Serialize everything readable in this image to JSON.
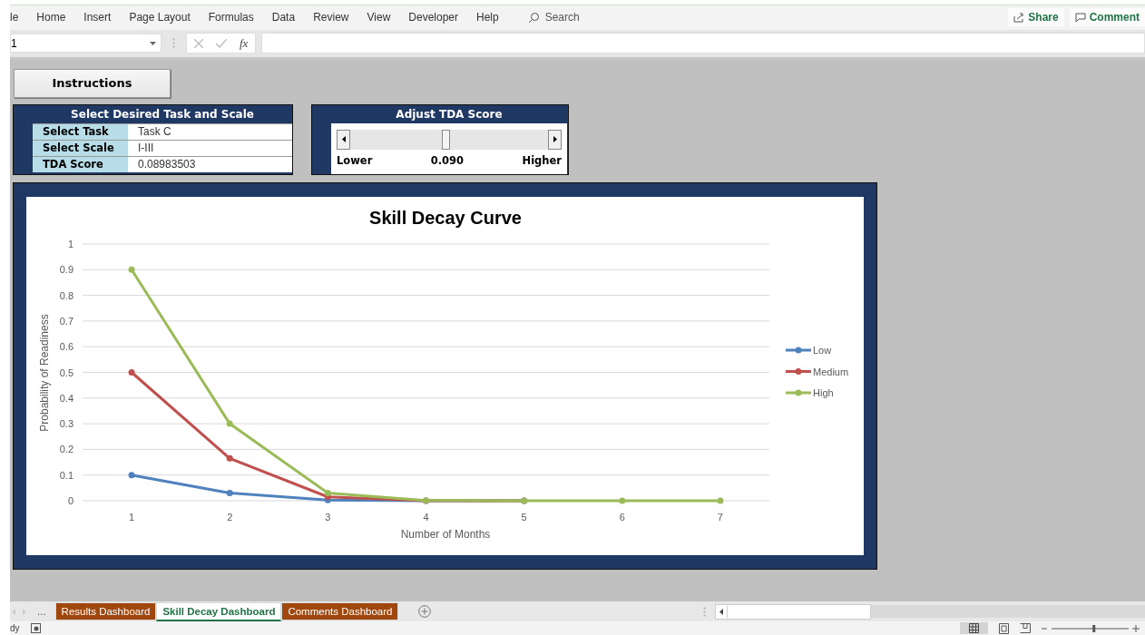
{
  "ribbon": {
    "tabs": [
      {
        "label": "le",
        "selected": false
      },
      {
        "label": "Home",
        "selected": false
      },
      {
        "label": "Insert",
        "selected": false
      },
      {
        "label": "Page Layout",
        "selected": false
      },
      {
        "label": "Formulas",
        "selected": false
      },
      {
        "label": "Data",
        "selected": false
      },
      {
        "label": "Review",
        "selected": false
      },
      {
        "label": "View",
        "selected": false
      },
      {
        "label": "Developer",
        "selected": false
      },
      {
        "label": "Help",
        "selected": false
      }
    ],
    "search": {
      "placeholder": "Search"
    },
    "buttons": [
      {
        "kind": "share",
        "label": "Share"
      },
      {
        "kind": "comment",
        "label": "Comment"
      }
    ]
  },
  "formula_bar": {
    "name_box": "1",
    "fx": "fx"
  },
  "instructions_button": "Instructions",
  "task_panel": {
    "title": "Select Desired Task and Scale",
    "rows": [
      {
        "label": "Select Task",
        "value": "Task C"
      },
      {
        "label": "Select Scale",
        "value": "I-III"
      },
      {
        "label": "TDA Score",
        "value": "0.08983503"
      }
    ]
  },
  "slider_panel": {
    "title": "Adjust TDA Score",
    "low_label": "Lower",
    "reading": "0.090",
    "high_label": "Higher"
  },
  "chart_data": {
    "type": "line",
    "title": "Skill Decay Curve",
    "xlabel": "Number of Months",
    "ylabel": "Probability of Readiness",
    "categories": [
      "1",
      "2",
      "3",
      "4",
      "5",
      "6",
      "7"
    ],
    "grid": true,
    "legend": true,
    "ylim": [
      0,
      1
    ],
    "yticks": [
      0,
      0.1,
      0.2,
      0.3,
      0.4,
      0.5,
      0.6,
      0.7,
      0.8,
      0.9,
      1
    ],
    "series": [
      {
        "name": "Low",
        "color": "#4f81bd",
        "marker": "circle",
        "values": [
          0.1,
          0.03,
          0.003,
          0,
          0,
          null,
          null
        ]
      },
      {
        "name": "Medium",
        "color": "#c0504d",
        "marker": "circle",
        "values": [
          0.5,
          0.165,
          0.015,
          0,
          0,
          null,
          null
        ]
      },
      {
        "name": "High",
        "color": "#9bbb59",
        "marker": "circle",
        "values": [
          0.9,
          0.3,
          0.03,
          0.001,
          0,
          0,
          0
        ]
      }
    ]
  },
  "sheet_tabs": {
    "more": "...",
    "tabs": [
      {
        "label": "Results Dashboard",
        "selected": false
      },
      {
        "label": "Skill Decay Dashboard",
        "selected": true
      },
      {
        "label": "Comments Dashboard",
        "selected": false
      }
    ]
  },
  "status_bar": {
    "status": "dy",
    "zoom": {
      "level": 0.55
    }
  }
}
